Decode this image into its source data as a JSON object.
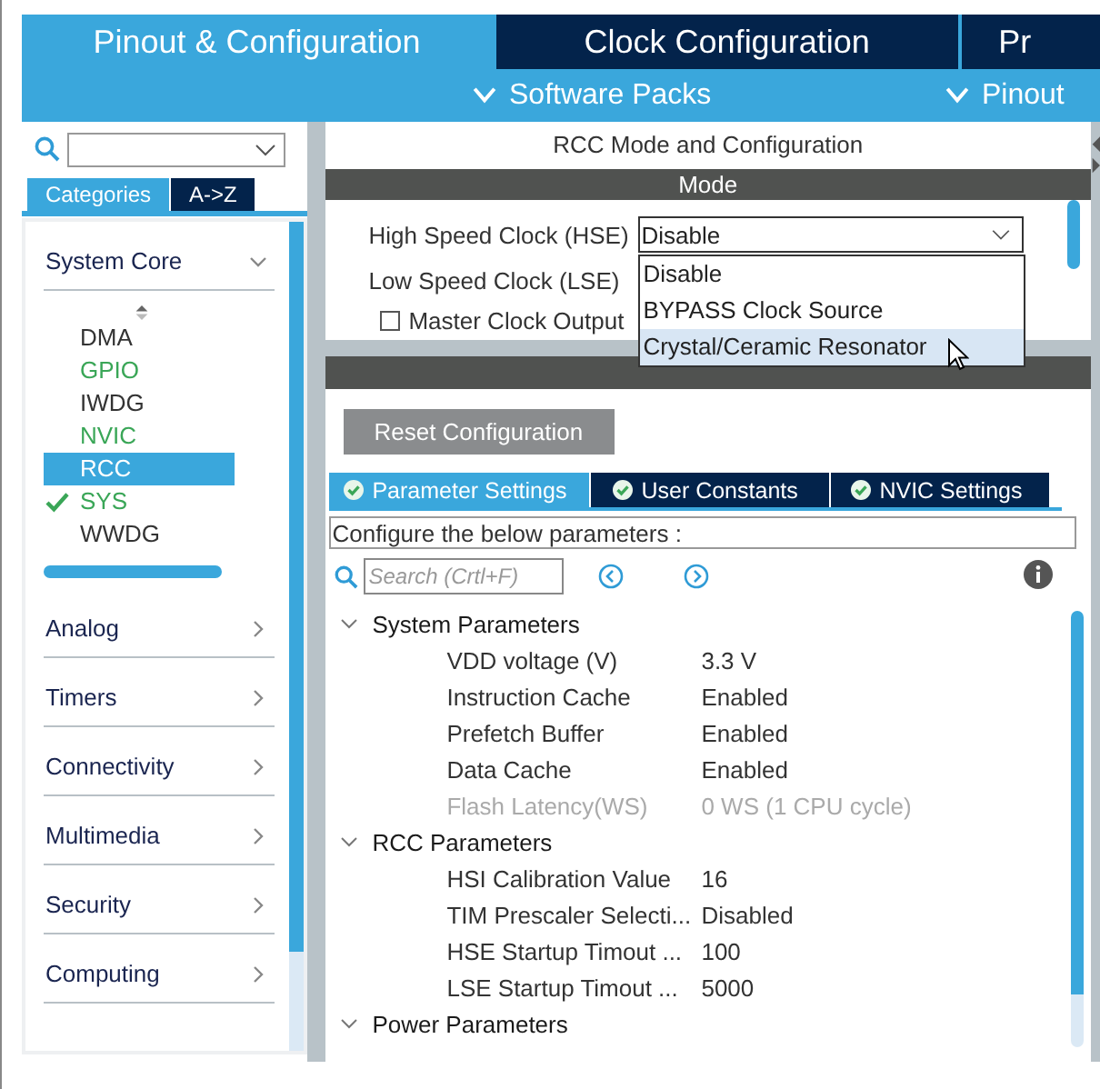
{
  "main_tabs": [
    {
      "label": "Pinout & Configuration",
      "selected": true
    },
    {
      "label": "Clock Configuration",
      "selected": false
    },
    {
      "label": "Pr",
      "selected": false
    }
  ],
  "sub_menus": [
    "Software Packs",
    "Pinout"
  ],
  "sidebar": {
    "view_tabs": [
      {
        "label": "Categories",
        "selected": true
      },
      {
        "label": "A->Z",
        "selected": false
      }
    ],
    "categories": [
      {
        "label": "System Core",
        "expanded": true,
        "items": [
          {
            "label": "DMA",
            "configured": false,
            "checked": false,
            "selected": false
          },
          {
            "label": "GPIO",
            "configured": true,
            "checked": false,
            "selected": false
          },
          {
            "label": "IWDG",
            "configured": false,
            "checked": false,
            "selected": false
          },
          {
            "label": "NVIC",
            "configured": true,
            "checked": false,
            "selected": false
          },
          {
            "label": "RCC",
            "configured": false,
            "checked": false,
            "selected": true
          },
          {
            "label": "SYS",
            "configured": true,
            "checked": true,
            "selected": false
          },
          {
            "label": "WWDG",
            "configured": false,
            "checked": false,
            "selected": false
          }
        ]
      },
      {
        "label": "Analog",
        "expanded": false
      },
      {
        "label": "Timers",
        "expanded": false
      },
      {
        "label": "Connectivity",
        "expanded": false
      },
      {
        "label": "Multimedia",
        "expanded": false
      },
      {
        "label": "Security",
        "expanded": false
      },
      {
        "label": "Computing",
        "expanded": false
      }
    ]
  },
  "panel": {
    "title": "RCC Mode and Configuration",
    "mode_header": "Mode",
    "fields": [
      {
        "label": "High Speed Clock (HSE)",
        "value": "Disable",
        "open": true
      },
      {
        "label": "Low Speed Clock (LSE)"
      }
    ],
    "dropdown_options": [
      {
        "label": "Disable",
        "selected": false
      },
      {
        "label": "BYPASS Clock Source",
        "selected": false
      },
      {
        "label": "Crystal/Ceramic Resonator",
        "selected": true
      }
    ],
    "checkbox": {
      "label": "Master Clock Output",
      "checked": false
    },
    "reset_button": "Reset Configuration",
    "param_tabs": [
      {
        "label": "Parameter Settings",
        "selected": true
      },
      {
        "label": "User Constants",
        "selected": false
      },
      {
        "label": "NVIC Settings",
        "selected": false
      }
    ],
    "hint": "Configure the below parameters :",
    "search": {
      "placeholder": "Search (Crtl+F)"
    },
    "groups": [
      {
        "label": "System Parameters",
        "expanded": true,
        "params": [
          {
            "name": "VDD voltage (V)",
            "value": "3.3 V",
            "disabled": false
          },
          {
            "name": "Instruction Cache",
            "value": "Enabled",
            "disabled": false
          },
          {
            "name": "Prefetch Buffer",
            "value": "Enabled",
            "disabled": false
          },
          {
            "name": "Data Cache",
            "value": "Enabled",
            "disabled": false
          },
          {
            "name": "Flash Latency(WS)",
            "value": "0 WS (1 CPU cycle)",
            "disabled": true
          }
        ]
      },
      {
        "label": "RCC Parameters",
        "expanded": true,
        "params": [
          {
            "name": "HSI Calibration Value",
            "value": "16",
            "disabled": false
          },
          {
            "name": "TIM Prescaler Selecti...",
            "value": "Disabled",
            "disabled": false
          },
          {
            "name": "HSE Startup Timout ...",
            "value": "100",
            "disabled": false
          },
          {
            "name": "LSE Startup Timout ...",
            "value": "5000",
            "disabled": false
          }
        ]
      },
      {
        "label": "Power Parameters",
        "expanded": true
      }
    ]
  }
}
